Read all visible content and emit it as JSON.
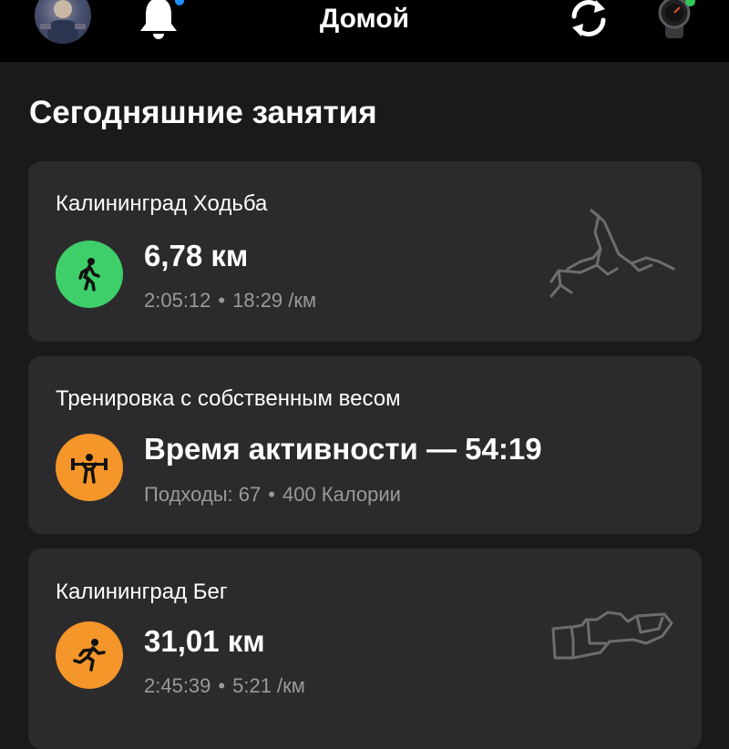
{
  "header": {
    "title": "Домой",
    "avatar_icon": "profile-avatar",
    "bell_icon": "bell-icon",
    "sync_icon": "sync-icon",
    "device_icon": "watch-icon",
    "accent_dot_color": "#1e90ff",
    "device_dot_color": "#33c659"
  },
  "section": {
    "title": "Сегодняшние занятия"
  },
  "activities": [
    {
      "title": "Калининград Ходьба",
      "main": "6,78 км",
      "sub1": "2:05:12",
      "sub2": "18:29 /км",
      "icon": "walking-icon",
      "icon_color": "#3fcf6a"
    },
    {
      "title": "Тренировка с собственным весом",
      "main": "Время активности — 54:19",
      "sub1": "Подходы: 67",
      "sub2": "400 Калории",
      "icon": "weightlifting-icon",
      "icon_color": "#f5962a"
    },
    {
      "title": "Калининград Бег",
      "main": "31,01 км",
      "sub1": "2:45:39",
      "sub2": "5:21 /км",
      "icon": "running-icon",
      "icon_color": "#f5962a"
    }
  ]
}
